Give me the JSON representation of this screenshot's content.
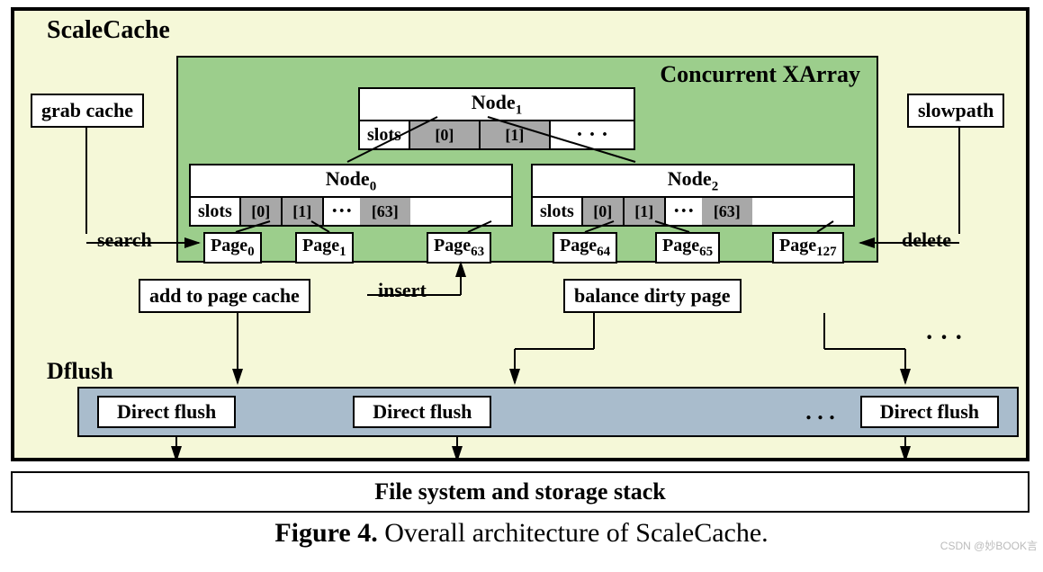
{
  "diagram": {
    "title": "ScaleCache",
    "xarray": {
      "title": "Concurrent XArray",
      "node1": {
        "title_base": "Node",
        "title_sub": "1",
        "slots_label": "slots",
        "slot0": "[0]",
        "slot1": "[1]",
        "dots": "· · ·"
      },
      "node0": {
        "title_base": "Node",
        "title_sub": "0",
        "slots_label": "slots",
        "slot0": "[0]",
        "slot1": "[1]",
        "dots": "···",
        "slot63": "[63]"
      },
      "node2": {
        "title_base": "Node",
        "title_sub": "2",
        "slots_label": "slots",
        "slot0": "[0]",
        "slot1": "[1]",
        "dots": "···",
        "slot63": "[63]"
      },
      "pages": {
        "p0_base": "Page",
        "p0_sub": "0",
        "p1_base": "Page",
        "p1_sub": "1",
        "p63_base": "Page",
        "p63_sub": "63",
        "p64_base": "Page",
        "p64_sub": "64",
        "p65_base": "Page",
        "p65_sub": "65",
        "p127_base": "Page",
        "p127_sub": "127"
      }
    },
    "labels": {
      "grab_cache": "grab cache",
      "slowpath": "slowpath",
      "search": "search",
      "delete": "delete",
      "add_to_page_cache": "add to page cache",
      "insert": "insert",
      "balance_dirty_page": "balance dirty page",
      "big_dots": "· · ·"
    },
    "dflush": {
      "title": "Dflush",
      "item": "Direct flush",
      "dots": ". . ."
    },
    "filesystem": "File system and storage stack"
  },
  "caption_bold": "Figure 4.",
  "caption_rest": " Overall architecture of ScaleCache.",
  "watermark": "CSDN @妙BOOK言"
}
